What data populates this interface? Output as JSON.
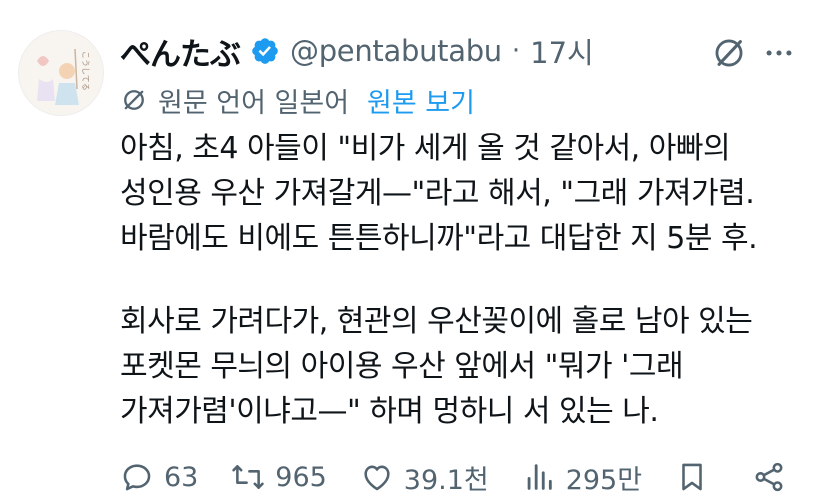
{
  "post": {
    "display_name": "ぺんたぶ",
    "handle": "@pentabutabu",
    "separator": "·",
    "time": "17시"
  },
  "translation": {
    "label": "원문 언어 일본어",
    "show_original": "원본 보기"
  },
  "body": {
    "lines": [
      "아침, 초4 아들이 \"비가 세게 올 것 같아서, 아빠의",
      "성인용 우산 가져갈게—\"라고 해서, \"그래 가져가렴.",
      "바람에도 비에도 튼튼하니까\"라고 대답한 지 5분 후.",
      "",
      "회사로 가려다가, 현관의 우산꽂이에 홀로 남아 있는",
      "포켓몬 무늬의 아이용 우산 앞에서 \"뭐가 '그래",
      "가져가렴'이냐고—\" 하며 멍하니 서 있는 나."
    ]
  },
  "actions": {
    "replies": "63",
    "reposts": "965",
    "likes": "39.1천",
    "views": "295만"
  },
  "colors": {
    "text": "#0f1419",
    "secondary": "#536471",
    "accent": "#1d9bf0"
  },
  "avatar": {
    "text": "こうしてる"
  }
}
